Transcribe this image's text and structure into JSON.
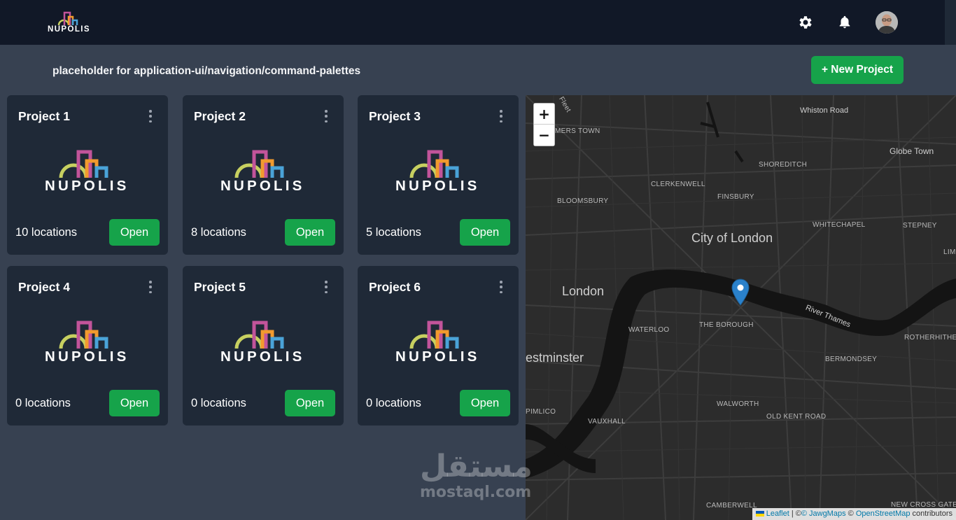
{
  "header": {
    "brand_name": "NUPOLIS",
    "settings_icon": "gear-icon",
    "notifications_icon": "bell-icon",
    "avatar_icon": "user-avatar"
  },
  "toolbar": {
    "subtitle": "placeholder for application-ui/navigation/command-palettes",
    "new_project_label": "+ New Project"
  },
  "projects": [
    {
      "title": "Project 1",
      "locations": "10 locations",
      "open_label": "Open",
      "logo_text": "NUPOLIS"
    },
    {
      "title": "Project 2",
      "locations": "8 locations",
      "open_label": "Open",
      "logo_text": "NUPOLIS"
    },
    {
      "title": "Project 3",
      "locations": "5 locations",
      "open_label": "Open",
      "logo_text": "NUPOLIS"
    },
    {
      "title": "Project 4",
      "locations": "0 locations",
      "open_label": "Open",
      "logo_text": "NUPOLIS"
    },
    {
      "title": "Project 5",
      "locations": "0 locations",
      "open_label": "Open",
      "logo_text": "NUPOLIS"
    },
    {
      "title": "Project 6",
      "locations": "0 locations",
      "open_label": "Open",
      "logo_text": "NUPOLIS"
    }
  ],
  "map": {
    "zoom_in": "+",
    "zoom_out": "−",
    "labels": {
      "fleet": "Fleet",
      "somers_town": "MERS TOWN",
      "whiston_road": "Whiston Road",
      "globe_town": "Globe Town",
      "shoreditch": "SHOREDITCH",
      "clerkenwell": "CLERKENWELL",
      "finsbury": "FINSBURY",
      "bloomsbury": "BLOOMSBURY",
      "whitechapel": "WHITECHAPEL",
      "stepney": "STEPNEY",
      "city_of_london": "City of London",
      "london": "London",
      "lim": "LIM",
      "river_thames": "River Thames",
      "waterloo": "WATERLOO",
      "the_borough": "THE BOROUGH",
      "rotherhithe": "ROTHERHITHE",
      "westminster": "estminster",
      "bermondsey": "BERMONDSEY",
      "walworth": "WALWORTH",
      "pimlico": "PIMLICO",
      "vauxhall": "VAUXHALL",
      "old_kent_road": "OLD KENT ROAD",
      "camberwell": "CAMBERWELL",
      "new_cross_gate": "NEW CROSS GATE"
    },
    "attribution": {
      "leaflet": "Leaflet",
      "sep1": " | ©",
      "jawg": "© JawgMaps",
      "sep2": " © ",
      "osm": "OpenStreetMap",
      "tail": " contributors"
    },
    "marker_icon": "map-pin-icon"
  },
  "watermark": {
    "arabic": "مستقل",
    "latin": "mostaql.com"
  }
}
